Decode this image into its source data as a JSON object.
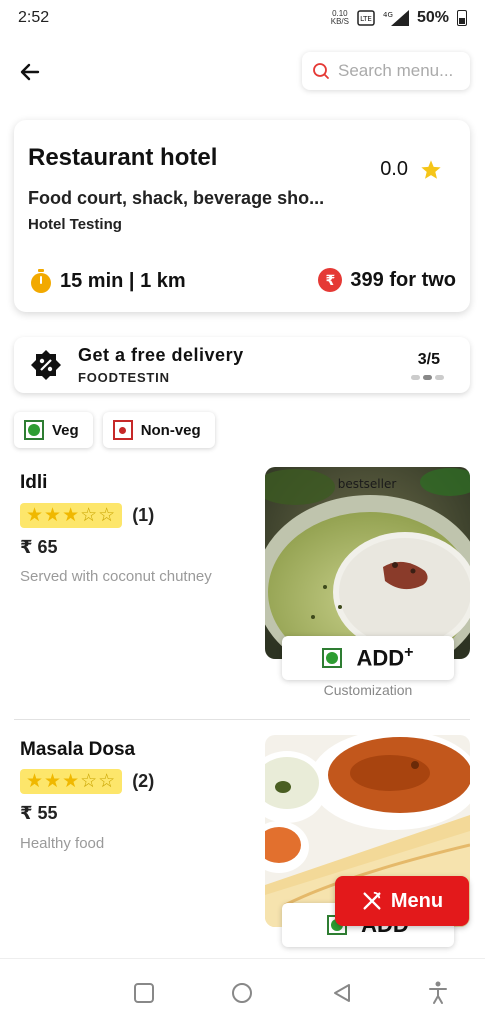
{
  "status_bar": {
    "time": "2:52",
    "net_speed_value": "0.10",
    "net_speed_unit": "KB/S",
    "network": "4G",
    "battery": "50%"
  },
  "top_bar": {
    "search_placeholder": "Search menu..."
  },
  "restaurant": {
    "name": "Restaurant hotel",
    "rating": "0.0",
    "cuisine": "Food court, shack, beverage sho...",
    "subtitle": "Hotel Testing",
    "time_distance": "15 min | 1 km",
    "price_for_two": "399 for two",
    "accent_star_color": "#f5c518",
    "accent_rupee_color": "#e53935"
  },
  "offer": {
    "title": "Get a free delivery",
    "code": "FOODTESTIN",
    "counter": "3/5"
  },
  "filters": [
    {
      "label": "Veg",
      "type": "veg"
    },
    {
      "label": "Non-veg",
      "type": "non-veg"
    }
  ],
  "items": [
    {
      "name": "Idli",
      "rating_stars": 3,
      "rating_max": 5,
      "rating_count": "(1)",
      "price": "₹ 65",
      "description": "Served with coconut chutney",
      "image_tag": "bestseller",
      "add_label": "ADD",
      "add_sup": "+",
      "customization_label": "Customization"
    },
    {
      "name": "Masala Dosa",
      "rating_stars": 3,
      "rating_max": 5,
      "rating_count": "(2)",
      "price": "₹ 55",
      "description": "Healthy food",
      "add_label": "ADD"
    }
  ],
  "menu_fab": {
    "label": "Menu",
    "color": "#e3191b"
  }
}
